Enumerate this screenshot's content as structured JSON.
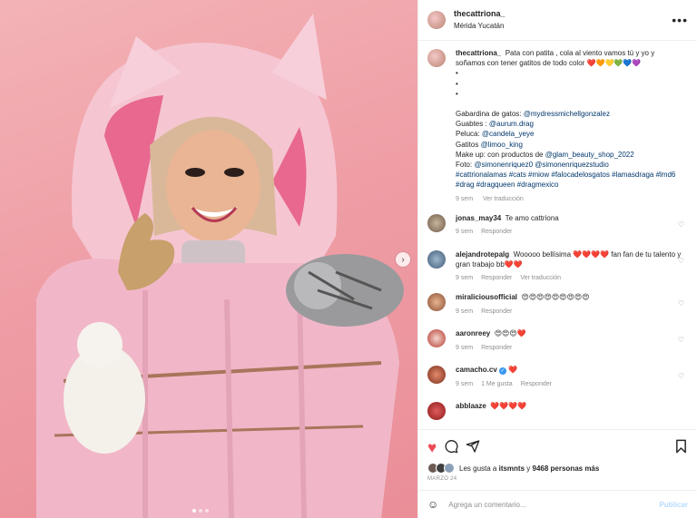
{
  "header": {
    "username": "thecattriona_",
    "location": "Mérida Yucatán",
    "more_icon": "more-horizontal-icon"
  },
  "caption": {
    "username": "thecattriona_",
    "text": "Pata con patita , cola al viento vamos tú y yo y soñamos con tener gatitos de todo color ❤️🧡💛💚💙💜",
    "dots": [
      "•",
      "•",
      "•"
    ],
    "credits": [
      {
        "label": "Gabardina de gatos: ",
        "link": "@mydressmichellgonzalez"
      },
      {
        "label": "Guabtes : ",
        "link": "@aurum.drag"
      },
      {
        "label": "Peluca: ",
        "link": "@candela_yeye"
      },
      {
        "label": "Gatitos ",
        "link": "@limoo_king"
      },
      {
        "label": "Make up: con productos de ",
        "link": "@glam_beauty_shop_2022"
      },
      {
        "label": "Foto: ",
        "link": "@simonenriquez0 @simonenriquezstudio"
      }
    ],
    "hashtags": "#cattrionalamas #cats #miow #falocadelosgatos #lamasdraga #lmd6 #drag #dragqueen #dragmexico",
    "time": "9 sem",
    "translate": "Ver traducción"
  },
  "comments": [
    {
      "user": "jonas_may34",
      "text": "Te amo cattriona",
      "time": "9 sem",
      "likes": "",
      "reply": "Responder",
      "translate": ""
    },
    {
      "user": "alejandrotepalg",
      "text": "Wooooo bellísima ❤️❤️❤️❤️ fan fan de tu talento y gran trabajo bb❤️❤️",
      "time": "9 sem",
      "likes": "",
      "reply": "Responder",
      "translate": "Ver traducción"
    },
    {
      "user": "miraliciousofficial",
      "text": "😍😍😍😍😍😍😍😍😍",
      "time": "9 sem",
      "likes": "",
      "reply": "Responder",
      "translate": ""
    },
    {
      "user": "aaronreey",
      "text": "😍😍😍❤️",
      "time": "9 sem",
      "likes": "",
      "reply": "Responder",
      "translate": ""
    },
    {
      "user": "camacho.cv",
      "text": "❤️",
      "verified": true,
      "time": "9 sem",
      "likes": "1 Me gusta",
      "reply": "Responder",
      "translate": ""
    },
    {
      "user": "abblaaze",
      "text": "❤️❤️❤️❤️",
      "time": "",
      "likes": "",
      "reply": "",
      "translate": ""
    }
  ],
  "actions": {
    "like_icon": "heart-filled-icon",
    "comment_icon": "comment-icon",
    "share_icon": "share-icon",
    "save_icon": "bookmark-icon",
    "likes_prefix": "Les gusta a ",
    "likes_user": "itsmnts",
    "likes_mid": " y ",
    "likes_count": "9468 personas más",
    "date": "MARZO 24"
  },
  "add_comment": {
    "placeholder": "Agrega un comentario...",
    "post_label": "Publicar",
    "emoji_icon": "smiley-icon"
  },
  "colors": {
    "like": "#ed4956",
    "link": "#00376b",
    "background_media": "#ef9ea6"
  }
}
